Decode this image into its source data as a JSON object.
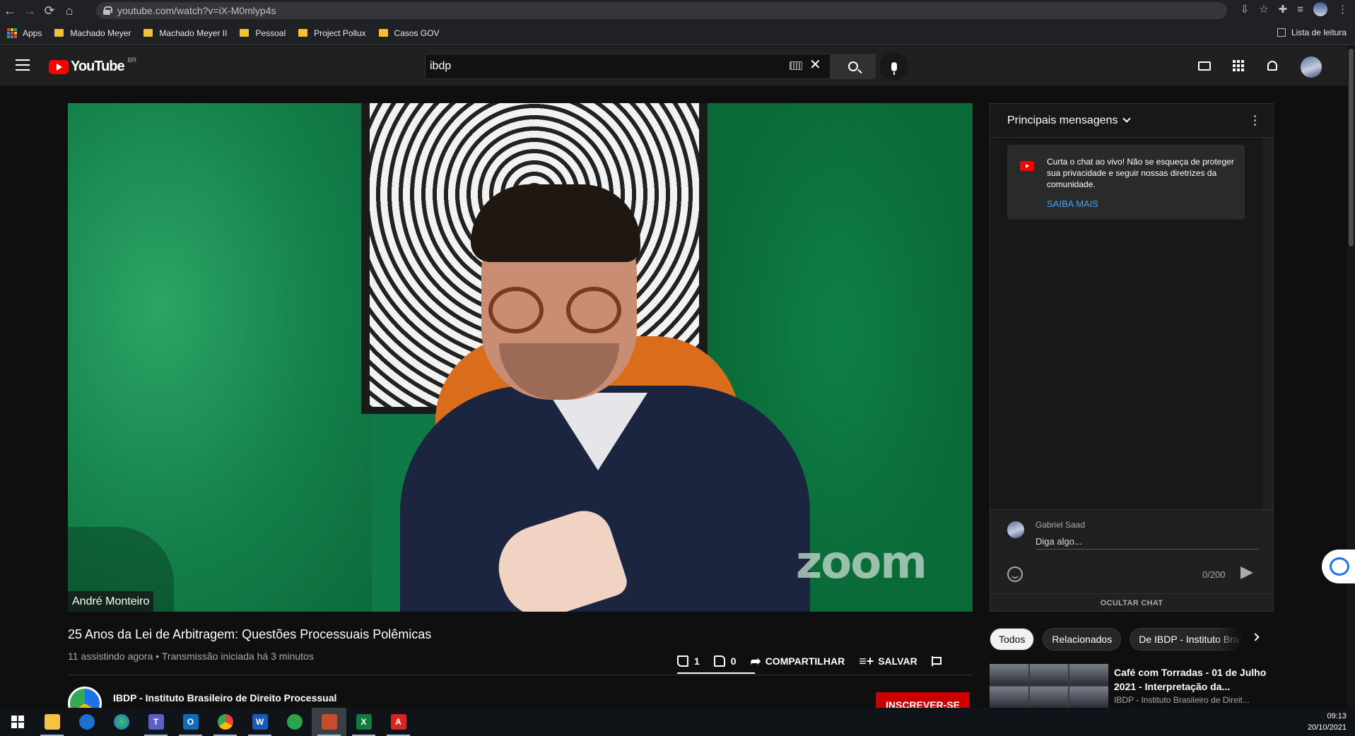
{
  "browser": {
    "url": "youtube.com/watch?v=iX-M0mlyp4s",
    "bookmarks": [
      {
        "label": "Apps"
      },
      {
        "label": "Machado Meyer"
      },
      {
        "label": "Machado Meyer II"
      },
      {
        "label": "Pessoal"
      },
      {
        "label": "Project Pollux"
      },
      {
        "label": "Casos GOV"
      }
    ],
    "reading_list_label": "Lista de leitura"
  },
  "youtube": {
    "logo_text": "YouTube",
    "country_code": "BR",
    "search_value": "ibdp"
  },
  "video": {
    "speaker_name": "André Monteiro",
    "watermark": "zoom",
    "title": "25 Anos da Lei de Arbitragem: Questões Processuais Polêmicas",
    "stats": "11 assistindo agora • Transmissão iniciada há 3 minutos",
    "likes": "1",
    "dislikes": "0",
    "share_label": "COMPARTILHAR",
    "save_label": "SALVAR",
    "channel_name": "IBDP - Instituto Brasileiro de Direito Processual",
    "subscribe_label": "INSCREVER-SE"
  },
  "chat": {
    "header": "Principais mensagens",
    "notice_text": "Curta o chat ao vivo! Não se esqueça de proteger sua privacidade e seguir nossas diretrizes da comunidade.",
    "notice_link": "SAIBA MAIS",
    "user_name": "Gabriel Saad",
    "input_placeholder": "Diga algo...",
    "char_count": "0/200",
    "hide_label": "OCULTAR CHAT"
  },
  "chips": [
    {
      "label": "Todos"
    },
    {
      "label": "Relacionados"
    },
    {
      "label": "De IBDP - Instituto Brasileiro"
    }
  ],
  "recommended": {
    "title": "Café com Torradas - 01 de Julho 2021 - Interpretação da...",
    "channel": "IBDP - Instituto Brasileiro de Direit..."
  },
  "taskbar": {
    "time": "09:13",
    "date": "20/10/2021"
  },
  "colors": {
    "youtube_red": "#ff0000",
    "subscribe_red": "#cc0000",
    "link_blue": "#3ea6ff",
    "background": "#0f0f0f"
  }
}
